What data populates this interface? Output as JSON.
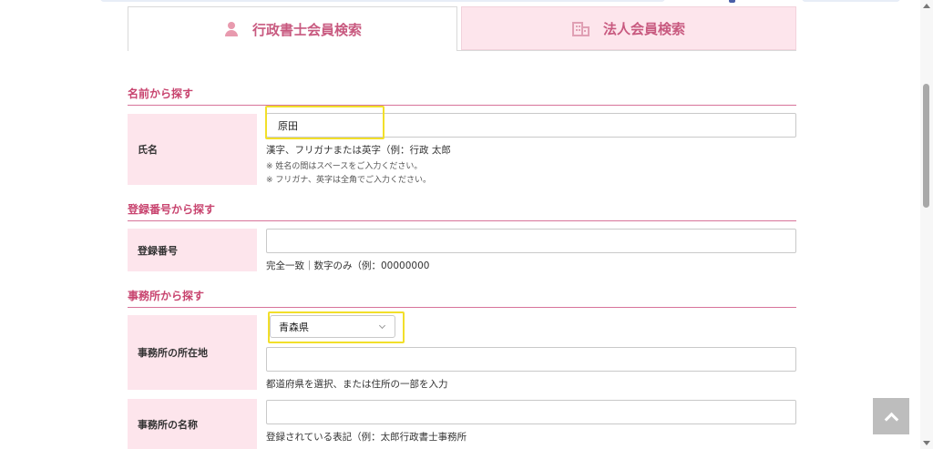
{
  "tabs": [
    {
      "label": "行政書士会員検索",
      "icon": "person-icon",
      "active": true
    },
    {
      "label": "法人会員検索",
      "icon": "building-icon",
      "active": false
    }
  ],
  "sections": {
    "name": {
      "title": "名前から探す",
      "label": "氏名",
      "value": "原田",
      "hint": "漢字、フリガナまたは英字（例：行政 太郎",
      "note1": "※ 姓名の間はスペースをご入力ください。",
      "note2": "※ フリガナ、英字は全角でご入力ください。"
    },
    "registration": {
      "title": "登録番号から探す",
      "label": "登録番号",
      "value": "",
      "hint": "完全一致｜数字のみ（例：00000000"
    },
    "office": {
      "title": "事務所から探す",
      "location_label": "事務所の所在地",
      "prefecture_selected": "青森県",
      "address_value": "",
      "location_hint": "都道府県を選択、または住所の一部を入力",
      "name_label": "事務所の名称",
      "name_value": "",
      "name_hint": "登録されている表記（例：太郎行政書士事務所"
    }
  },
  "colors": {
    "accent": "#c8446f",
    "label_bg": "#fde5ec",
    "highlight": "#f2df2a"
  }
}
